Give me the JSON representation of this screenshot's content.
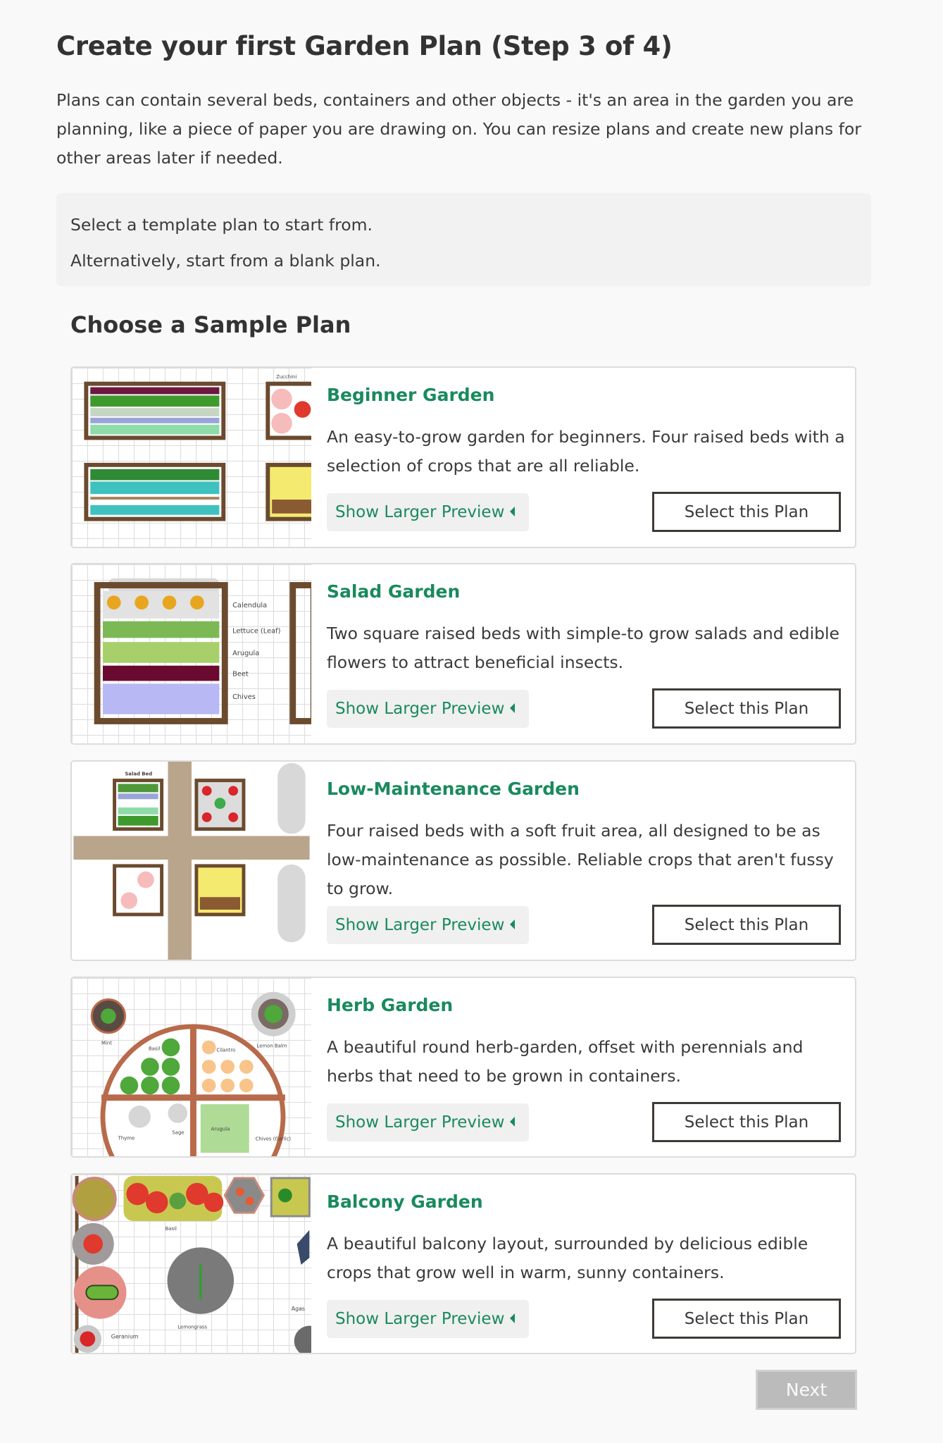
{
  "page": {
    "title": "Create your first Garden Plan (Step 3 of 4)",
    "intro": "Plans can contain several beds, containers and other objects - it's an area in the garden you are planning, like a piece of paper you are drawing on. You can resize plans and create new plans for other areas later if needed."
  },
  "info_box": {
    "line1": "Select a template plan to start from.",
    "line2": "Alternatively, start from a blank plan."
  },
  "section_title": "Choose a Sample Plan",
  "colors": {
    "accent_green": "#1a8a5e",
    "button_border": "#3e3a36",
    "next_disabled_bg": "#bbbbbb"
  },
  "plans": [
    {
      "title": "Beginner Garden",
      "description": "An easy-to-grow garden for beginners. Four raised beds with a selection of crops that are all reliable.",
      "preview_label": "Show Larger Preview",
      "select_label": "Select this Plan",
      "thumb_labels": [
        "Zucchini"
      ]
    },
    {
      "title": "Salad Garden",
      "description": "Two square raised beds with simple-to grow salads and edible flowers to attract beneficial insects.",
      "preview_label": "Show Larger Preview",
      "select_label": "Select this Plan",
      "thumb_labels": [
        "Calendula",
        "Lettuce (Leaf)",
        "Arugula",
        "Beet",
        "Chives"
      ]
    },
    {
      "title": "Low-Maintenance Garden",
      "description": "Four raised beds with a soft fruit area, all designed to be as low-maintenance as possible. Reliable crops that aren't fussy to grow.",
      "preview_label": "Show Larger Preview",
      "select_label": "Select this Plan",
      "thumb_labels": [
        "Salad Bed"
      ]
    },
    {
      "title": "Herb Garden",
      "description": "A beautiful round herb-garden, offset with perennials and herbs that need to be grown in containers.",
      "preview_label": "Show Larger Preview",
      "select_label": "Select this Plan",
      "thumb_labels": [
        "Mint",
        "Lemon Balm",
        "Basil",
        "Cilantro",
        "Thyme",
        "Sage",
        "Arugula",
        "Chives (Garlic)"
      ]
    },
    {
      "title": "Balcony Garden",
      "description": "A beautiful balcony layout, surrounded by delicious edible crops that grow well in warm, sunny containers.",
      "preview_label": "Show Larger Preview",
      "select_label": "Select this Plan",
      "thumb_labels": [
        "Basil",
        "Lemongrass",
        "Geranium",
        "Agas"
      ]
    }
  ],
  "next_label": "Next",
  "icons": {
    "preview_caret": "caret-left-icon"
  }
}
